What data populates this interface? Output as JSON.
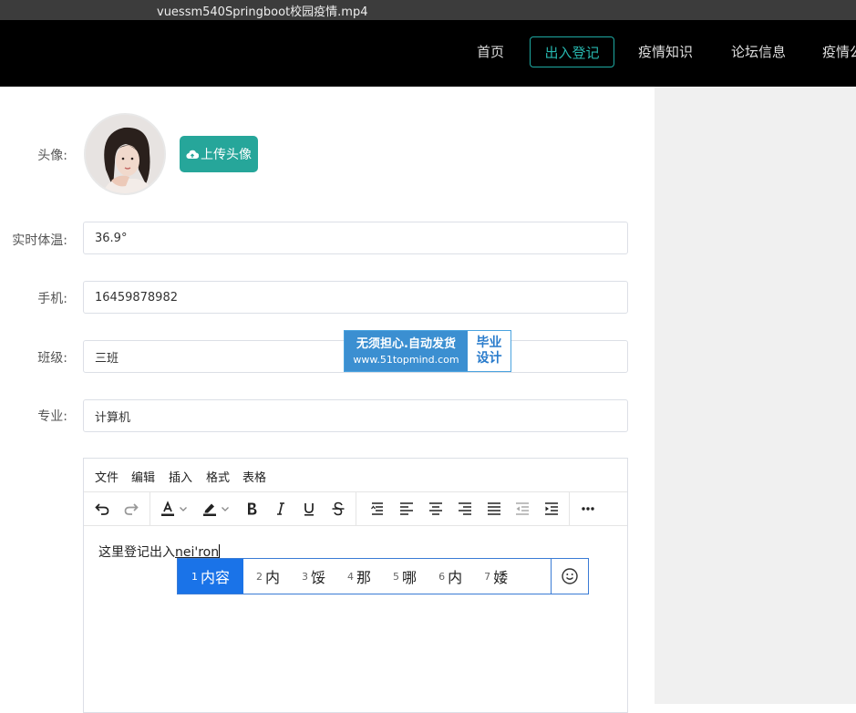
{
  "window": {
    "title": "vuessm540Springboot校园疫情.mp4"
  },
  "nav": {
    "items": [
      {
        "label": "首页",
        "active": false
      },
      {
        "label": "出入登记",
        "active": true
      },
      {
        "label": "疫情知识",
        "active": false
      },
      {
        "label": "论坛信息",
        "active": false
      },
      {
        "label": "疫情公",
        "active": false
      }
    ]
  },
  "form": {
    "avatar_label": "头像:",
    "upload_label": "上传头像",
    "temperature": {
      "label": "实时体温:",
      "value": "36.9°"
    },
    "phone": {
      "label": "手机:",
      "value": "16459878982"
    },
    "class": {
      "label": "班级:",
      "value": "三班"
    },
    "major": {
      "label": "专业:",
      "value": "计算机"
    }
  },
  "editor": {
    "menu": [
      "文件",
      "编辑",
      "插入",
      "格式",
      "表格"
    ],
    "content_text": "这里登记出入",
    "composition_text": "nei'ron"
  },
  "ime": {
    "candidates": [
      {
        "num": "1",
        "text": "内容"
      },
      {
        "num": "2",
        "text": "内"
      },
      {
        "num": "3",
        "text": "馁"
      },
      {
        "num": "4",
        "text": "那"
      },
      {
        "num": "5",
        "text": "哪"
      },
      {
        "num": "6",
        "text": "内"
      },
      {
        "num": "7",
        "text": "婑"
      }
    ]
  },
  "watermark": {
    "line1": "无须担心.自动发货",
    "line2": "www.51topmind.com",
    "right1": "毕业",
    "right2": "设计"
  },
  "colors": {
    "accent": "#26a69a",
    "ime_selected": "#1a73e8",
    "watermark_blue": "#3b8fd1"
  }
}
